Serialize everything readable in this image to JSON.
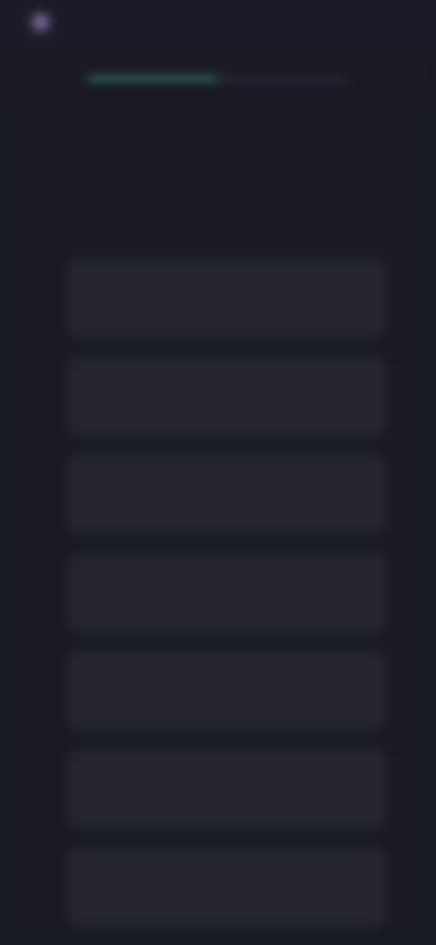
{
  "header": {
    "brand_icon": "brand-logo-icon",
    "brand_name": "",
    "progress": 0.5
  },
  "question": {
    "text": ""
  },
  "options": [
    {
      "label": ""
    },
    {
      "label": ""
    },
    {
      "label": ""
    },
    {
      "label": ""
    },
    {
      "label": ""
    },
    {
      "label": ""
    },
    {
      "label": ""
    }
  ],
  "colors": {
    "background": "#191a22",
    "card": "#24252f",
    "accent": "#2f6f66"
  }
}
